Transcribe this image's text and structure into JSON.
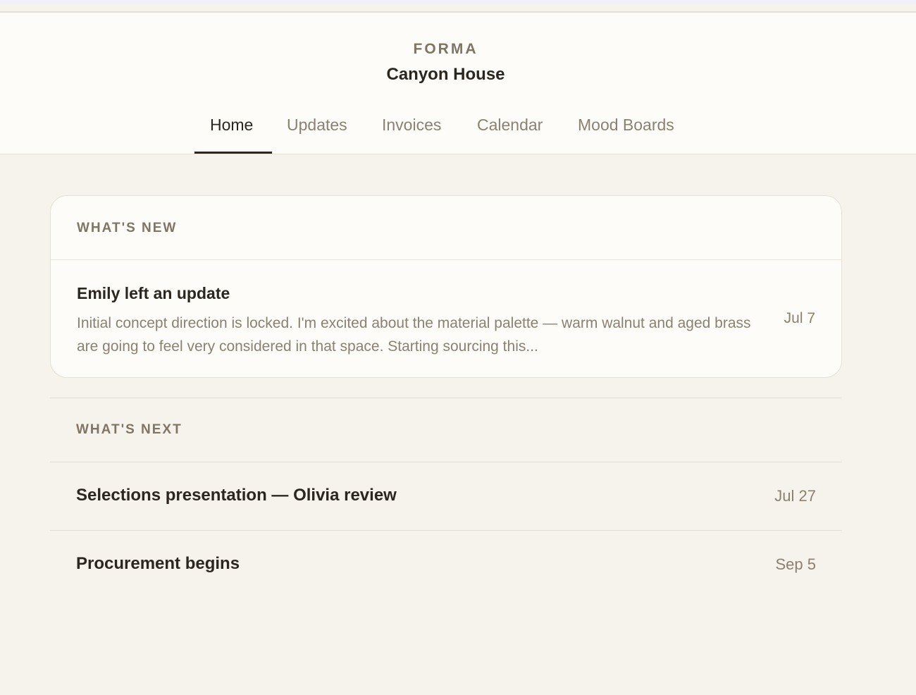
{
  "header": {
    "brand": "FORMA",
    "project": "Canyon House"
  },
  "nav": {
    "tabs": [
      {
        "label": "Home",
        "active": true
      },
      {
        "label": "Updates",
        "active": false
      },
      {
        "label": "Invoices",
        "active": false
      },
      {
        "label": "Calendar",
        "active": false
      },
      {
        "label": "Mood Boards",
        "active": false
      }
    ]
  },
  "whats_new": {
    "label": "WHAT'S NEW",
    "items": [
      {
        "title": "Emily left an update",
        "body": "Initial concept direction is locked. I'm excited about the material palette — warm walnut and aged brass are going to feel very considered in that space. Starting sourcing this...",
        "date": "Jul 7"
      }
    ]
  },
  "whats_next": {
    "label": "WHAT'S NEXT",
    "items": [
      {
        "title": "Selections presentation — Olivia review",
        "date": "Jul 27"
      },
      {
        "title": "Procurement begins",
        "date": "Sep 5"
      }
    ]
  },
  "colors": {
    "background": "#f6f2ec",
    "surface": "#fdfcf8",
    "text_primary": "#2b2620",
    "text_muted": "#8a8172",
    "label": "#7f7565",
    "border": "#e6e0d7"
  }
}
